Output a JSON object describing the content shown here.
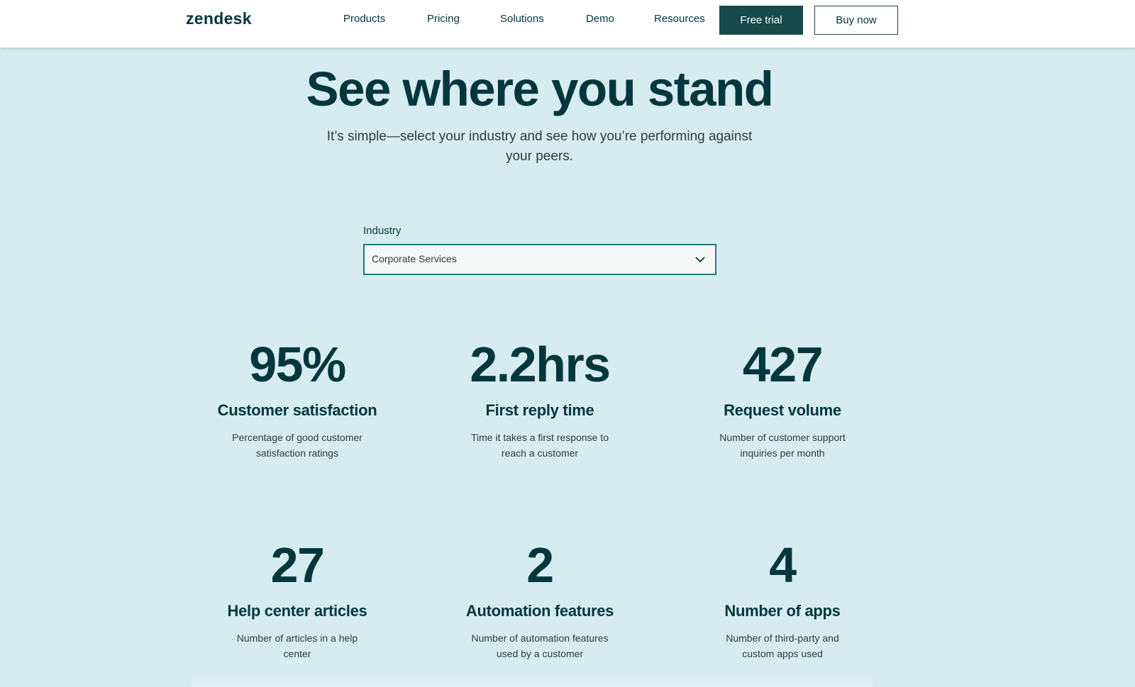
{
  "header": {
    "logo": "zendesk",
    "nav": [
      "Products",
      "Pricing",
      "Solutions",
      "Demo",
      "Resources"
    ],
    "free_trial": "Free trial",
    "buy_now": "Buy now"
  },
  "hero": {
    "title": "See where you stand",
    "subtitle": "It’s simple—select your industry and see how you’re performing against your peers."
  },
  "industry": {
    "label": "Industry",
    "selected": "Corporate Services",
    "icon": "chevron-down-icon"
  },
  "stats": [
    {
      "value": "95%",
      "title": "Customer satisfaction",
      "desc": "Percentage of good customer satisfaction ratings"
    },
    {
      "value": "2.2hrs",
      "title": "First reply time",
      "desc": "Time it takes a first response to reach a customer"
    },
    {
      "value": "427",
      "title": "Request volume",
      "desc": "Number of customer support inquiries per month"
    },
    {
      "value": "27",
      "title": "Help center articles",
      "desc": "Number of articles in a help center"
    },
    {
      "value": "2",
      "title": "Automation features",
      "desc": "Number of automation features used by a customer"
    },
    {
      "value": "4",
      "title": "Number of apps",
      "desc": "Number of third-party and custom apps used"
    }
  ],
  "colors": {
    "background": "#d6ecf1",
    "brand_dark": "#03363d",
    "button": "#17494d",
    "select_border": "#1f7a7a"
  }
}
